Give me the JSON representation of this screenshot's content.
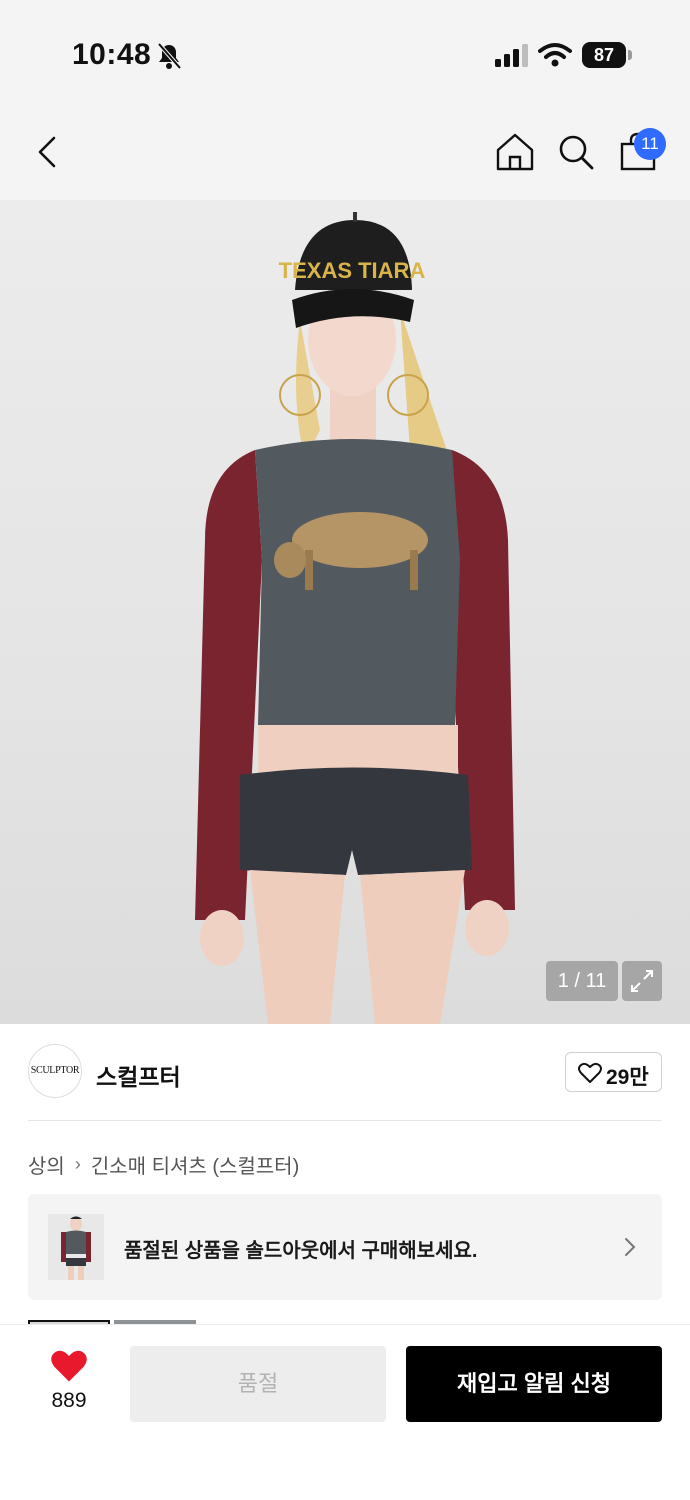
{
  "status_bar": {
    "time": "10:48",
    "battery": "87",
    "icons": [
      "bell-off-icon",
      "cellular-signal-icon",
      "wifi-icon",
      "battery-icon"
    ]
  },
  "nav": {
    "icons": [
      "back-icon",
      "home-icon",
      "search-icon",
      "shopping-bag-icon"
    ],
    "cart_count": "11"
  },
  "gallery": {
    "counter": "1 / 11",
    "cap_text": "TEXAS TIARA",
    "icons": [
      "expand-icon"
    ]
  },
  "brand": {
    "logo_text": "SCULPTOR",
    "name": "스컬프터",
    "likes": "29만"
  },
  "breadcrumb": {
    "items": [
      "상의",
      "긴소매 티셔츠 (스컬프터)"
    ]
  },
  "soldout_banner": {
    "text": "품절된 상품을 솔드아웃에서 구매해보세요."
  },
  "bottom_bar": {
    "like_count": "889",
    "soldout_label": "품절",
    "restock_label": "재입고 알림 신청",
    "colors": {
      "heart": "#e8192c",
      "primary": "#000000",
      "badge": "#2f6bff"
    }
  }
}
